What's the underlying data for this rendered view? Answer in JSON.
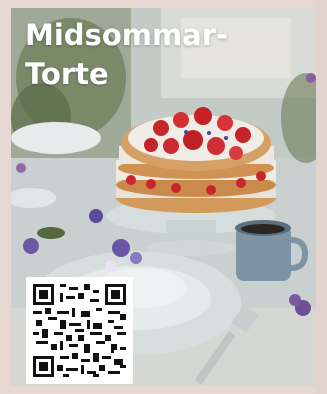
{
  "card": {
    "title": "Midsommar-\nTorte",
    "image_subject": "strawberry-layer-cake-on-garden-table",
    "qr_code_icon": "qr-code-icon"
  },
  "colors": {
    "page_background": "#e7d7d3",
    "title_text": "#ffffff",
    "qr_background": "#ffffff"
  }
}
